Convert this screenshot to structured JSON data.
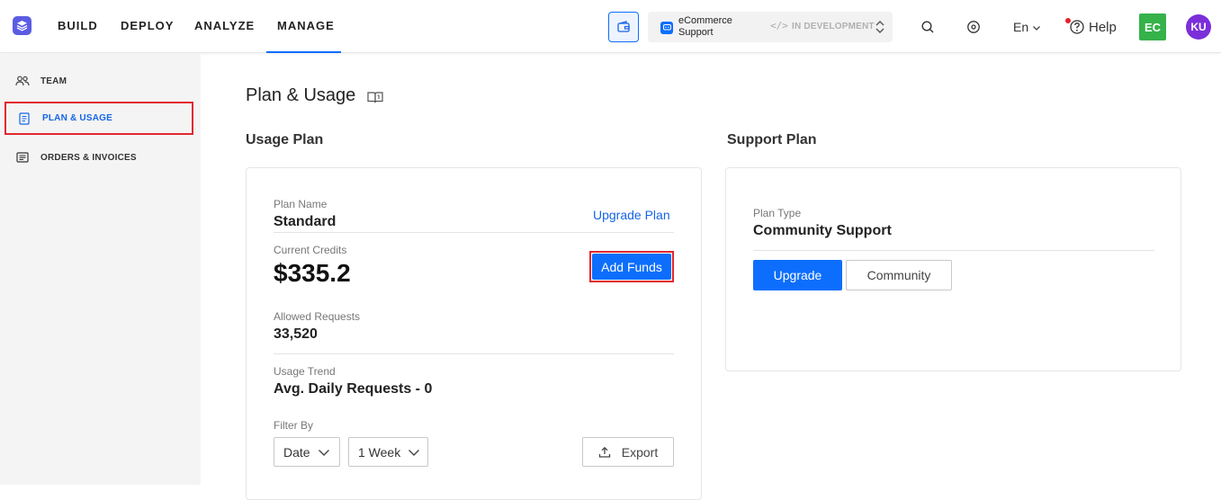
{
  "nav": {
    "build": "BUILD",
    "deploy": "DEPLOY",
    "analyze": "ANALYZE",
    "manage": "MANAGE",
    "active": "MANAGE"
  },
  "app_switcher": {
    "name": "eCommerce Support",
    "status": "IN DEVELOPMENT"
  },
  "header": {
    "language": "En",
    "help": "Help",
    "avatar_primary": "EC",
    "avatar_user": "KU"
  },
  "sidebar": {
    "items": [
      {
        "label": "TEAM",
        "icon": "team-icon",
        "active": false
      },
      {
        "label": "PLAN & USAGE",
        "icon": "document-icon",
        "active": true
      },
      {
        "label": "ORDERS & INVOICES",
        "icon": "invoice-icon",
        "active": false
      }
    ]
  },
  "page": {
    "title": "Plan & Usage"
  },
  "usage_plan": {
    "section_title": "Usage Plan",
    "plan_name_label": "Plan Name",
    "plan_name": "Standard",
    "upgrade_link": "Upgrade Plan",
    "credits_label": "Current Credits",
    "credits_value": "$335.2",
    "add_funds": "Add Funds",
    "allowed_label": "Allowed Requests",
    "allowed_value": "33,520",
    "trend_label": "Usage Trend",
    "trend_value": "Avg. Daily Requests - 0",
    "filter_label": "Filter By",
    "filter_field": "Date",
    "filter_range": "1 Week",
    "export": "Export"
  },
  "support_plan": {
    "section_title": "Support Plan",
    "type_label": "Plan Type",
    "type_value": "Community Support",
    "upgrade_button": "Upgrade",
    "community_button": "Community"
  },
  "colors": {
    "accent": "#0d6efd",
    "highlight": "#e3262f",
    "avatar_primary": "#36b24a",
    "avatar_user": "#7b2fd9",
    "logo": "#5b5ce2"
  }
}
